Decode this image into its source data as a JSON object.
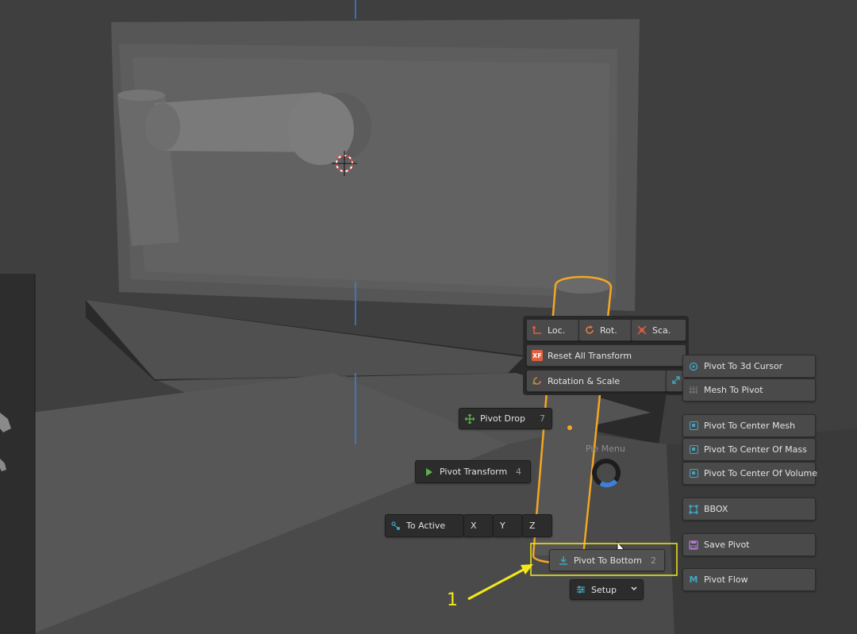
{
  "pie": {
    "label": "Pie Menu",
    "top_row": [
      {
        "label": "Loc.",
        "icon": "location-arrows-icon"
      },
      {
        "label": "Rot.",
        "icon": "rotate-icon"
      },
      {
        "label": "Sca.",
        "icon": "scale-arrows-icon"
      }
    ],
    "reset": {
      "label": "Reset All Transform",
      "icon": "xf-badge-icon",
      "badge": "XF"
    },
    "rotscale": {
      "label": "Rotation & Scale",
      "icon": "rotation-scale-icon"
    },
    "pivot_drop": {
      "label": "Pivot Drop",
      "key": "7"
    },
    "pivot_transform": {
      "label": "Pivot Transform",
      "key": "4"
    },
    "to_active": {
      "label": "To Active",
      "axes": [
        "X",
        "Y",
        "Z"
      ]
    },
    "pivot_bottom": {
      "label": "Pivot To Bottom",
      "key": "2"
    },
    "setup": {
      "label": "Setup"
    }
  },
  "right_panel": [
    "Pivot To 3d Cursor",
    "Mesh To Pivot",
    "Pivot To Center Mesh",
    "Pivot To Center Of Mass",
    "Pivot To Center Of Volume",
    "BBOX",
    "Save Pivot",
    "Pivot Flow"
  ],
  "annotation": {
    "number": "1",
    "color": "#f2e81c"
  },
  "colors": {
    "selection": "#f5a623",
    "axis": "#3f7fd6",
    "icon_teal": "#3fa7c4",
    "xf_red": "#e06040"
  }
}
